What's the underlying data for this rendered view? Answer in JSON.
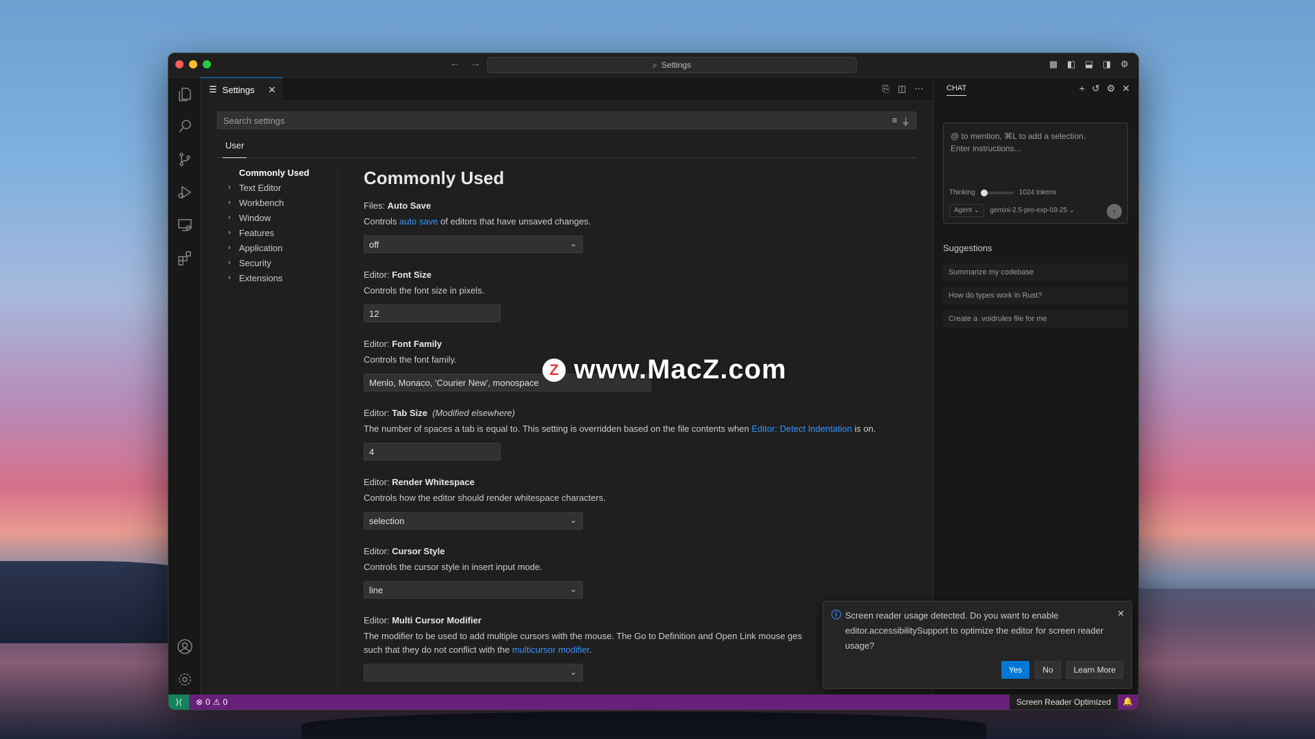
{
  "window": {
    "title": "Settings"
  },
  "titlebar": {
    "back_icon": "arrow-left-icon",
    "forward_icon": "arrow-right-icon"
  },
  "tab": {
    "label": "Settings",
    "close": "✕"
  },
  "search": {
    "placeholder": "Search settings"
  },
  "scope": {
    "user_label": "User"
  },
  "toc": {
    "active": "Commonly Used",
    "items": [
      "Text Editor",
      "Workbench",
      "Window",
      "Features",
      "Application",
      "Security",
      "Extensions"
    ]
  },
  "settings": {
    "group_title": "Commonly Used",
    "auto_save": {
      "category": "Files: ",
      "name": "Auto Save",
      "desc_pre": "Controls ",
      "desc_link": "auto save",
      "desc_post": " of editors that have unsaved changes.",
      "value": "off"
    },
    "font_size": {
      "category": "Editor: ",
      "name": "Font Size",
      "desc": "Controls the font size in pixels.",
      "value": "12"
    },
    "font_family": {
      "category": "Editor: ",
      "name": "Font Family",
      "desc": "Controls the font family.",
      "value": "Menlo, Monaco, 'Courier New', monospace"
    },
    "tab_size": {
      "category": "Editor: ",
      "name": "Tab Size",
      "modified": "(Modified elsewhere)",
      "desc_pre": "The number of spaces a tab is equal to. This setting is overridden based on the file contents when ",
      "desc_link": "Editor: Detect Indentation",
      "desc_post": " is on.",
      "value": "4"
    },
    "render_ws": {
      "category": "Editor: ",
      "name": "Render Whitespace",
      "desc": "Controls how the editor should render whitespace characters.",
      "value": "selection"
    },
    "cursor_style": {
      "category": "Editor: ",
      "name": "Cursor Style",
      "desc": "Controls the cursor style in insert input mode.",
      "value": "line"
    },
    "multi_cursor": {
      "category": "Editor: ",
      "name": "Multi Cursor Modifier",
      "desc1": "The modifier to be used to add multiple cursors with the mouse. The Go to Definition and Open Link mouse ges",
      "desc2_pre": "such that they do not conflict with the ",
      "desc2_link": "multicursor modifier",
      "desc2_post": "."
    }
  },
  "chat": {
    "title": "CHAT",
    "placeholder_line1": "@ to mention, ⌘L to add a selection.",
    "placeholder_line2": "Enter instructions...",
    "thinking_label": "Thinking",
    "thinking_value": 0,
    "tokens": "1024 tokens",
    "mode": "Agent",
    "model": "gemini-2.5-pro-exp-03-25",
    "suggestions_title": "Suggestions",
    "suggestions": [
      "Summarize my codebase",
      "How do types work in Rust?",
      "Create a .voidrules file for me"
    ]
  },
  "notification": {
    "text": "Screen reader usage detected. Do you want to enable editor.accessibilitySupport to optimize the editor for screen reader usage?",
    "yes": "Yes",
    "no": "No",
    "learn": "Learn More"
  },
  "statusbar": {
    "errors": "0",
    "warnings": "0",
    "sr_mode": "Screen Reader Optimized"
  },
  "watermark": {
    "logo": "Z",
    "text": "www.MacZ.com"
  },
  "colors": {
    "accent": "#0078d4",
    "statusbar": "#68217a",
    "link": "#3794ff"
  }
}
